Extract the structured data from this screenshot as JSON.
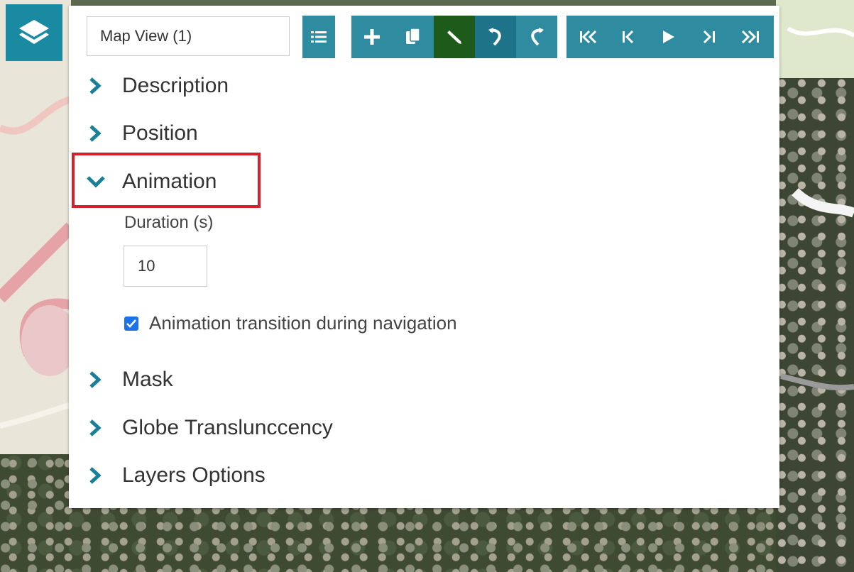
{
  "map_view": {
    "value": "Map View (1)"
  },
  "sections": {
    "description": "Description",
    "position": "Position",
    "animation": "Animation",
    "mask": "Mask",
    "globe": "Globe Translunccency",
    "layers": "Layers Options"
  },
  "animation": {
    "duration_label": "Duration (s)",
    "duration_value": "10",
    "transition_label": "Animation transition during navigation",
    "transition_checked": true
  },
  "toolbar": {
    "icons": [
      "list-icon",
      "plus-icon",
      "copy-icon",
      "pencil-icon",
      "undo-icon",
      "redo-icon",
      "first-icon",
      "previous-icon",
      "play-icon",
      "next-icon",
      "last-icon"
    ],
    "accent": "#2f8ba0",
    "active_color": "#1e5b1b"
  },
  "colors": {
    "highlight": "#d3202c",
    "chevron": "#1a7f98"
  }
}
